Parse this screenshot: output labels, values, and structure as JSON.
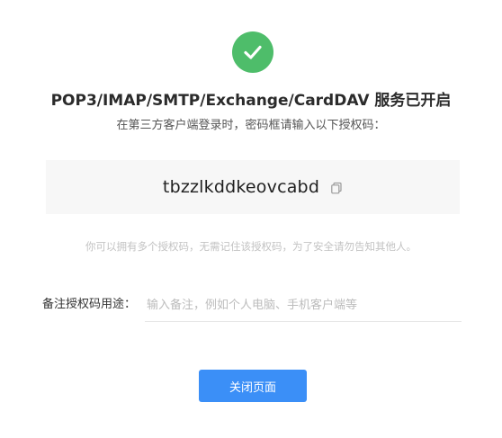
{
  "header": {
    "title": "POP3/IMAP/SMTP/Exchange/CardDAV 服务已开启",
    "subtitle": "在第三方客户端登录时，密码框请输入以下授权码：",
    "success_icon": "check-circle-icon",
    "success_color": "#4ebd6a"
  },
  "auth_code": {
    "value": "tbzzlkddkeovcabd",
    "copy_icon": "copy-icon"
  },
  "hint": "你可以拥有多个授权码，无需记住该授权码，为了安全请勿告知其他人。",
  "remark": {
    "label": "备注授权码用途：",
    "placeholder": "输入备注，例如个人电脑、手机客户端等",
    "value": ""
  },
  "footer": {
    "close_label": "关闭页面",
    "button_color": "#3b8ff7"
  }
}
